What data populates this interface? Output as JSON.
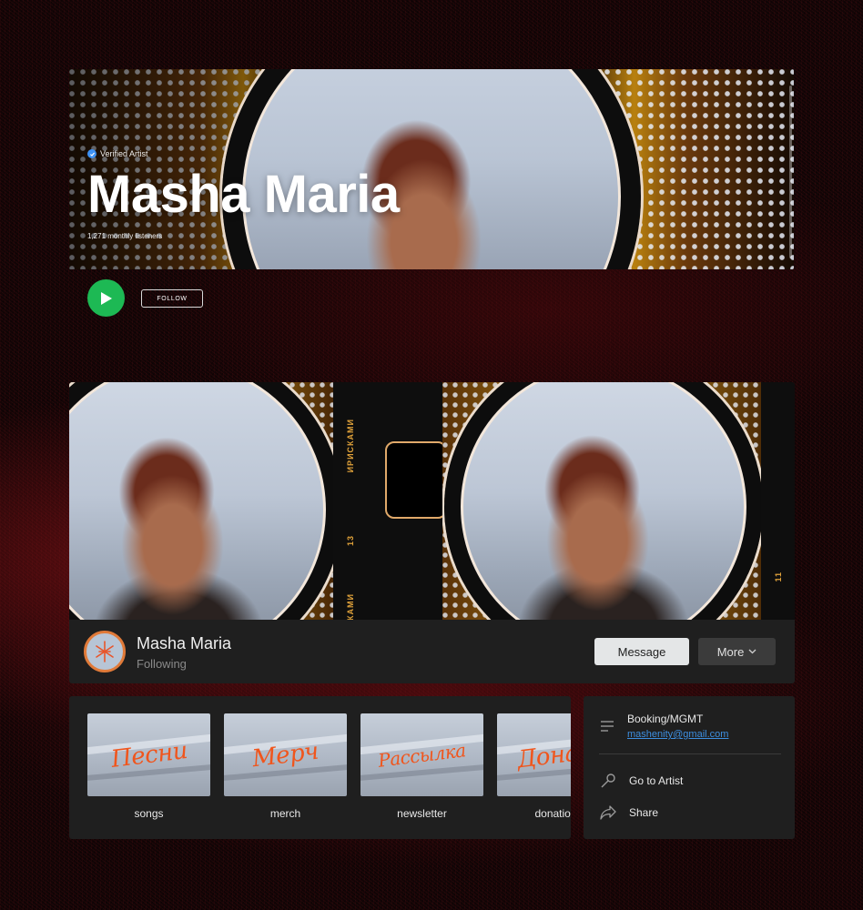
{
  "hero": {
    "verified_label": "Verified Artist",
    "artist_name": "Masha Maria",
    "monthly_listeners": "1,271 monthly listeners",
    "follow_label": "FOLLOW"
  },
  "cover": {
    "film_text_1": "ИРИСКАМИ",
    "film_text_2": "13",
    "film_text_3": "ИРИСКАМИ",
    "film_text_4": "11"
  },
  "profile": {
    "name": "Masha Maria",
    "status": "Following",
    "message_label": "Message",
    "more_label": "More"
  },
  "links": [
    {
      "image_text": "Песни",
      "label": "songs"
    },
    {
      "image_text": "Мерч",
      "label": "merch"
    },
    {
      "image_text": "Рассылка",
      "label": "newsletter"
    },
    {
      "image_text": "Донат",
      "label": "donations"
    }
  ],
  "info": {
    "booking_title": "Booking/MGMT",
    "booking_email": "mashenity@gmail.com",
    "go_to_artist": "Go to Artist",
    "share": "Share"
  },
  "colors": {
    "play": "#1db954",
    "verified": "#3d91f4",
    "link": "#3d8fe0",
    "card": "#1f1f1f",
    "scribble": "#f0551c"
  }
}
